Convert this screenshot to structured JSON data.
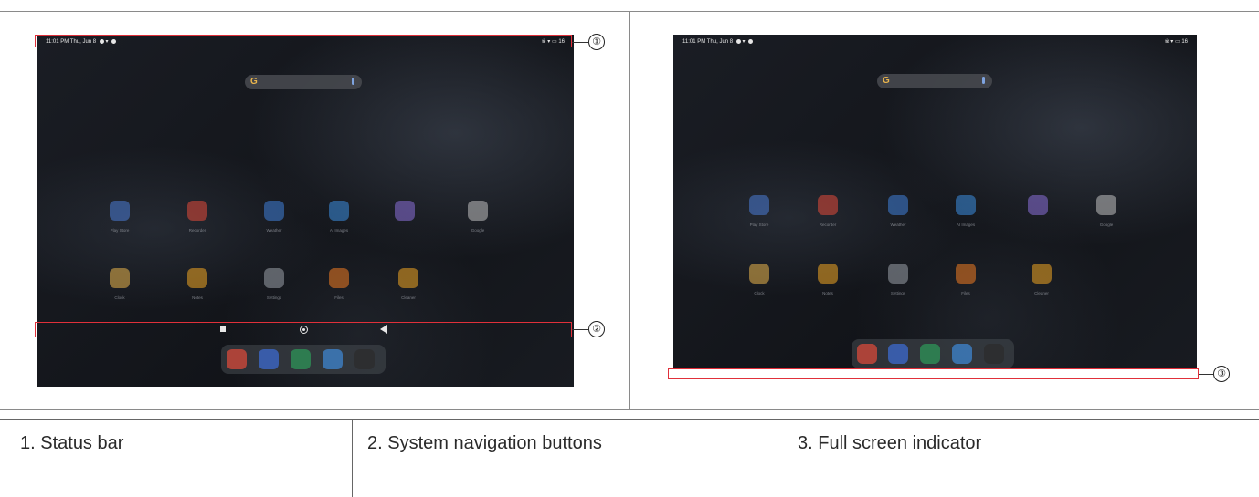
{
  "screens": {
    "status_time": "11:01 PM Thu, Jun 8",
    "status_battery": "16",
    "apps_row1": [
      "Play Store",
      "Recorder",
      "Weather",
      "AI Images",
      "",
      "Google"
    ],
    "apps_row2": [
      "Clock",
      "Notes",
      "Settings",
      "Files",
      "Cleaner"
    ]
  },
  "callouts": {
    "one": "①",
    "two": "②",
    "three": "③"
  },
  "table": {
    "cell1": "1. Status bar",
    "cell2": "2. System navigation buttons",
    "cell3": "3. Full screen indicator"
  },
  "colors": {
    "highlight": "#e0303a",
    "screen_bg": "#14171d",
    "app_colors": [
      "#4a7bd6",
      "#e24a3b",
      "#3f7fd9",
      "#3d8ee0",
      "#8a6fd8",
      "#bfbfbf",
      "#e9b44c",
      "#f0a623",
      "#9aa0a8",
      "#f17c22",
      "#f0a623"
    ]
  }
}
